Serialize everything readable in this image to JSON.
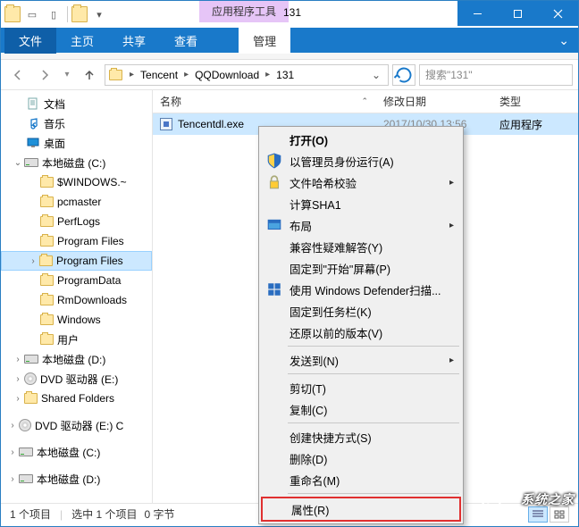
{
  "titlebar": {
    "tool_tab": "应用程序工具",
    "title": "131"
  },
  "ribbon": {
    "file": "文件",
    "home": "主页",
    "share": "共享",
    "view": "查看",
    "manage": "管理"
  },
  "breadcrumb": {
    "items": [
      "Tencent",
      "QQDownload",
      "131"
    ]
  },
  "search": {
    "placeholder": "搜索\"131\""
  },
  "columns": {
    "name": "名称",
    "date": "修改日期",
    "type": "类型"
  },
  "file": {
    "name": "Tencentdl.exe",
    "date": "2017/10/30 13:56",
    "type": "应用程序"
  },
  "tree": {
    "docs": "文档",
    "music": "音乐",
    "desktop": "桌面",
    "driveC": "本地磁盘 (C:)",
    "c_children": [
      "$WINDOWS.~",
      "pcmaster",
      "PerfLogs",
      "Program Files",
      "Program Files",
      "ProgramData",
      "RmDownloads",
      "Windows",
      "用户"
    ],
    "driveD": "本地磁盘 (D:)",
    "dvdD": "DVD 驱动器 (E:)",
    "shared": "Shared Folders",
    "dvdE": "DVD 驱动器 (E:) C",
    "driveC2": "本地磁盘 (C:)",
    "driveD2": "本地磁盘 (D:)"
  },
  "context_menu": {
    "open": "打开(O)",
    "admin": "以管理员身份运行(A)",
    "hash": "文件哈希校验",
    "sha1": "计算SHA1",
    "layout": "布局",
    "compat": "兼容性疑难解答(Y)",
    "pin_start": "固定到\"开始\"屏幕(P)",
    "defender": "使用 Windows Defender扫描...",
    "pin_taskbar": "固定到任务栏(K)",
    "restore": "还原以前的版本(V)",
    "sendto": "发送到(N)",
    "cut": "剪切(T)",
    "copy": "复制(C)",
    "shortcut": "创建快捷方式(S)",
    "delete": "删除(D)",
    "rename": "重命名(M)",
    "properties": "属性(R)"
  },
  "statusbar": {
    "items": "1 个项目",
    "selected": "选中 1 个项目",
    "size": "0 字节"
  },
  "watermark": "系统之家"
}
